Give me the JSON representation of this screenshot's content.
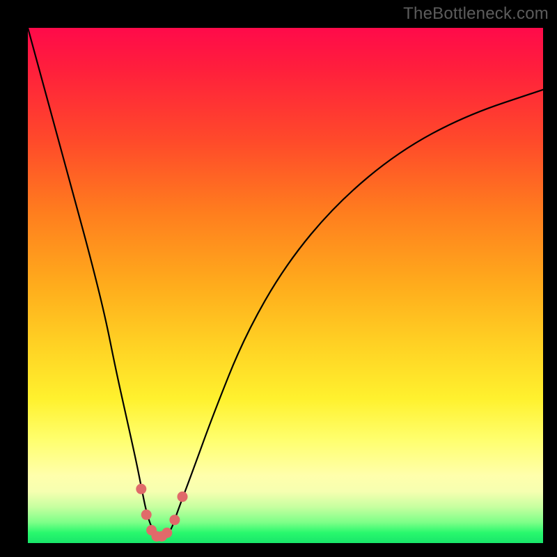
{
  "watermark": "TheBottleneck.com",
  "colors": {
    "curve": "#000000",
    "dot": "#e06a6a",
    "frame": "#000000"
  },
  "chart_data": {
    "type": "line",
    "title": "",
    "xlabel": "",
    "ylabel": "",
    "xlim": [
      0,
      100
    ],
    "ylim": [
      0,
      100
    ],
    "grid": false,
    "legend": false,
    "annotations": [
      "TheBottleneck.com"
    ],
    "series": [
      {
        "name": "bottleneck-curve",
        "x": [
          0,
          3,
          6,
          9,
          12,
          15,
          17,
          19,
          21,
          22,
          23,
          24,
          25,
          26,
          27,
          28,
          29,
          32,
          36,
          42,
          50,
          60,
          72,
          85,
          100
        ],
        "values": [
          100,
          89,
          78,
          67,
          56,
          44,
          34,
          25,
          16,
          11,
          6,
          3,
          1.5,
          1,
          1.5,
          3,
          6,
          14,
          25,
          40,
          54,
          66,
          76,
          83,
          88
        ]
      }
    ],
    "markers": [
      {
        "x": 22.0,
        "y": 10.5
      },
      {
        "x": 23.0,
        "y": 5.5
      },
      {
        "x": 24.0,
        "y": 2.5
      },
      {
        "x": 25.0,
        "y": 1.3
      },
      {
        "x": 26.0,
        "y": 1.3
      },
      {
        "x": 27.0,
        "y": 2.0
      },
      {
        "x": 28.5,
        "y": 4.5
      },
      {
        "x": 30.0,
        "y": 9.0
      }
    ]
  }
}
